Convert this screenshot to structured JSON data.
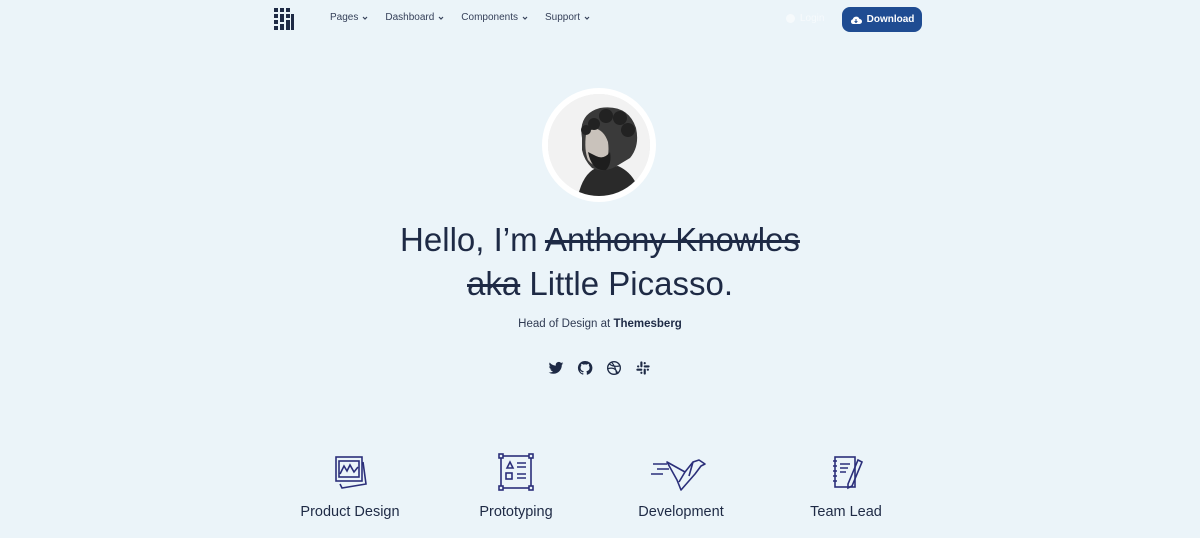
{
  "nav": {
    "items": [
      {
        "label": "Pages"
      },
      {
        "label": "Dashboard"
      },
      {
        "label": "Components"
      },
      {
        "label": "Support"
      }
    ],
    "login_label": "Login",
    "download_label": "Download"
  },
  "hero": {
    "greeting": "Hello, I’m",
    "struck_name": "Anthony Knowles",
    "struck_aka": "aka",
    "nickname": "Little Picasso.",
    "role": "Head of Design at",
    "company": "Themesberg"
  },
  "socials": [
    {
      "icon": "twitter-icon"
    },
    {
      "icon": "github-icon"
    },
    {
      "icon": "dribbble-icon"
    },
    {
      "icon": "slack-icon"
    }
  ],
  "skills": [
    {
      "label": "Product Design",
      "icon": "product-design-icon"
    },
    {
      "label": "Prototyping",
      "icon": "prototyping-icon"
    },
    {
      "label": "Development",
      "icon": "development-icon"
    },
    {
      "label": "Team Lead",
      "icon": "team-lead-icon"
    }
  ],
  "colors": {
    "background": "#ebf4f9",
    "primary": "#1f4c92",
    "text": "#1e2a45",
    "icon_stroke": "#2b2f7a"
  }
}
